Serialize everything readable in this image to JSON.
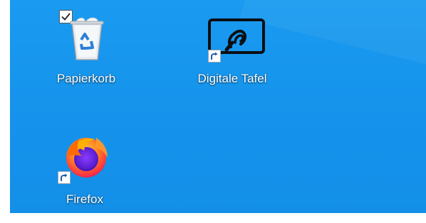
{
  "desktop": {
    "background_color": "#1593ec",
    "icons": [
      {
        "label": "Papierkorb",
        "icon": "recycle-bin-icon",
        "selected_checkbox": true
      },
      {
        "label": "Digitale Tafel",
        "icon": "digital-whiteboard-icon",
        "shortcut": true
      },
      {
        "label": "Firefox",
        "icon": "firefox-icon",
        "shortcut": true
      }
    ]
  }
}
